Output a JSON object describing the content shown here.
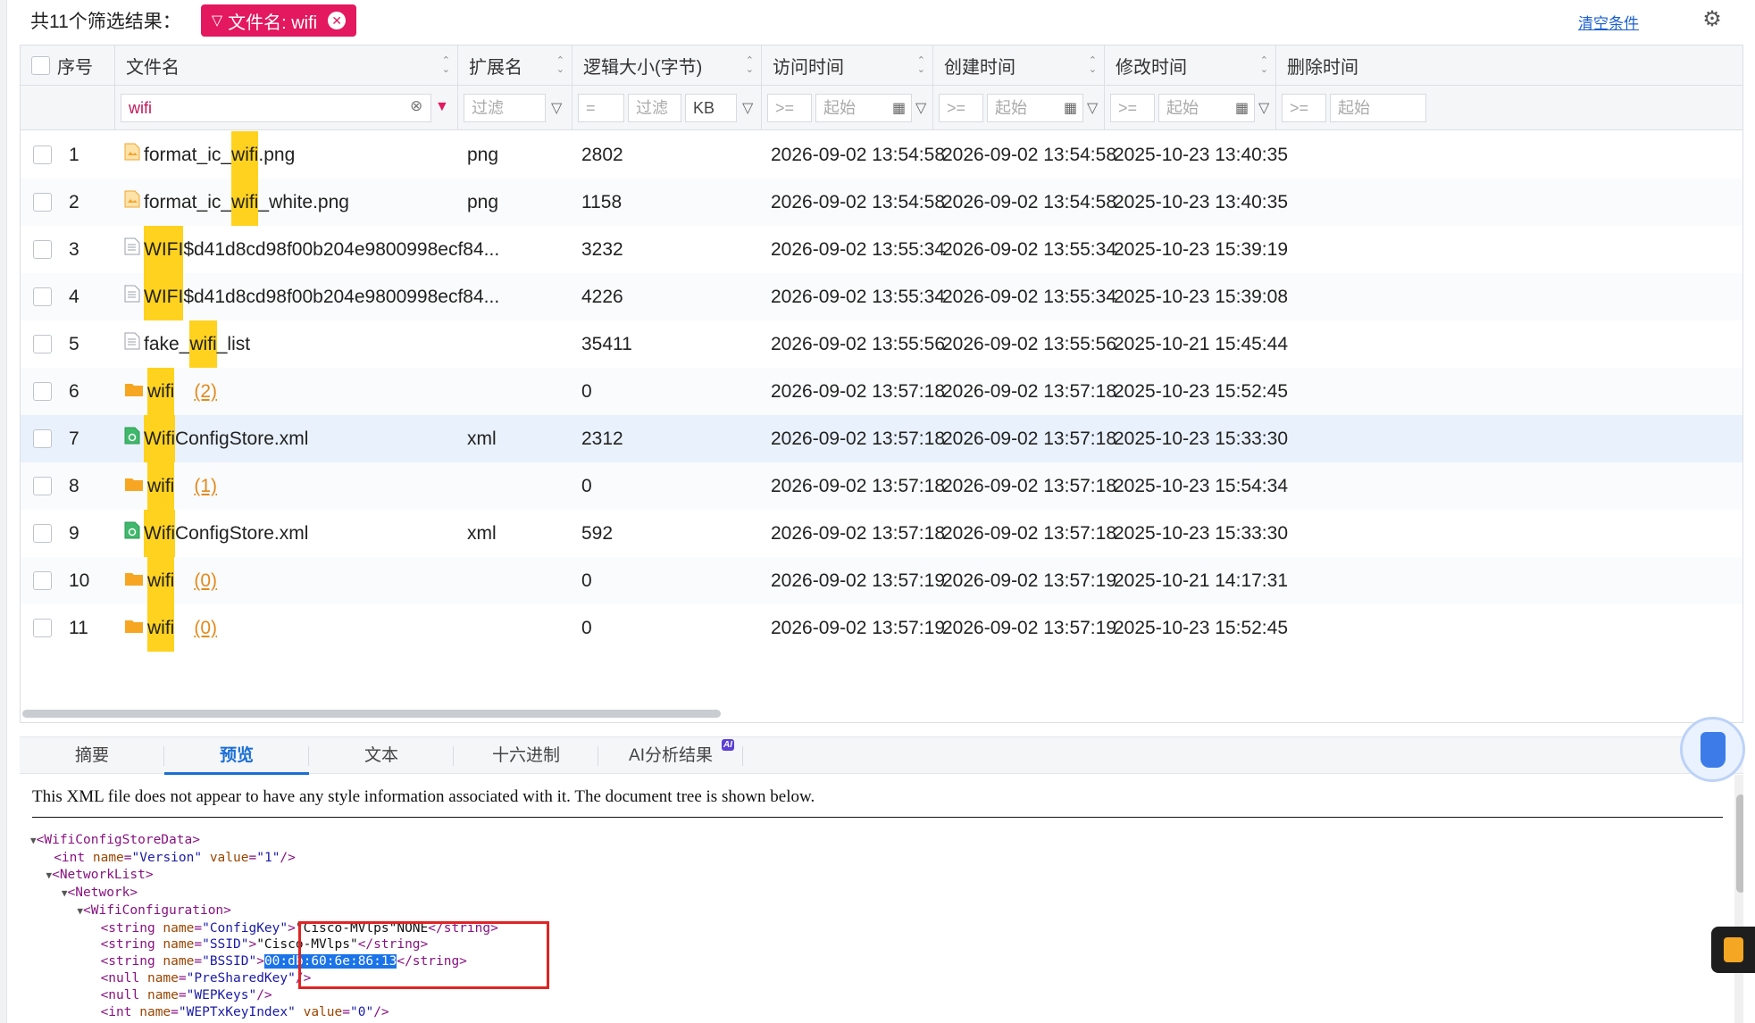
{
  "topbar": {
    "result_count": "共11个筛选结果：",
    "filter_chip": "文件名: wifi",
    "clear_label": "清空条件"
  },
  "columns": {
    "seq": "序号",
    "name": "文件名",
    "ext": "扩展名",
    "size": "逻辑大小(字节)",
    "access": "访问时间",
    "created": "创建时间",
    "modified": "修改时间",
    "deleted": "删除时间"
  },
  "filters": {
    "name_value": "wifi",
    "ext_placeholder": "过滤",
    "size_op": "=",
    "size_placeholder": "过滤",
    "size_unit": "KB",
    "time_op": ">=",
    "time_placeholder": "起始"
  },
  "rows": [
    {
      "seq": "1",
      "icon": "image-file-icon",
      "pre": "format_ic_",
      "hl": "wifi",
      "post": ".png",
      "count": "",
      "ext": "png",
      "size": "2802",
      "access": "2026-09-02 13:54:58",
      "created": "2026-09-02 13:54:58",
      "modified": "2025-10-23 13:40:35"
    },
    {
      "seq": "2",
      "icon": "image-file-icon",
      "pre": "format_ic_",
      "hl": "wifi",
      "post": "_white.png",
      "count": "",
      "ext": "png",
      "size": "1158",
      "access": "2026-09-02 13:54:58",
      "created": "2026-09-02 13:54:58",
      "modified": "2025-10-23 13:40:35"
    },
    {
      "seq": "3",
      "icon": "text-file-icon",
      "pre": "",
      "hl": "WIFI",
      "post": "$d41d8cd98f00b204e9800998ecf84...",
      "count": "",
      "ext": "",
      "size": "3232",
      "access": "2026-09-02 13:55:34",
      "created": "2026-09-02 13:55:34",
      "modified": "2025-10-23 15:39:19"
    },
    {
      "seq": "4",
      "icon": "text-file-icon",
      "pre": "",
      "hl": "WIFI",
      "post": "$d41d8cd98f00b204e9800998ecf84...",
      "count": "",
      "ext": "",
      "size": "4226",
      "access": "2026-09-02 13:55:34",
      "created": "2026-09-02 13:55:34",
      "modified": "2025-10-23 15:39:08"
    },
    {
      "seq": "5",
      "icon": "text-file-icon",
      "pre": "fake_",
      "hl": "wifi",
      "post": "_list",
      "count": "",
      "ext": "",
      "size": "35411",
      "access": "2026-09-02 13:55:56",
      "created": "2026-09-02 13:55:56",
      "modified": "2025-10-21 15:45:44"
    },
    {
      "seq": "6",
      "icon": "folder-icon",
      "pre": "",
      "hl": "wifi",
      "post": "",
      "count": "(2)",
      "ext": "",
      "size": "0",
      "access": "2026-09-02 13:57:18",
      "created": "2026-09-02 13:57:18",
      "modified": "2025-10-23 15:52:45"
    },
    {
      "seq": "7",
      "icon": "xml-file-icon",
      "pre": "",
      "hl": "Wifi",
      "post": "ConfigStore.xml",
      "count": "",
      "ext": "xml",
      "size": "2312",
      "access": "2026-09-02 13:57:18",
      "created": "2026-09-02 13:57:18",
      "modified": "2025-10-23 15:33:30"
    },
    {
      "seq": "8",
      "icon": "folder-icon",
      "pre": "",
      "hl": "wifi",
      "post": "",
      "count": "(1)",
      "ext": "",
      "size": "0",
      "access": "2026-09-02 13:57:18",
      "created": "2026-09-02 13:57:18",
      "modified": "2025-10-23 15:54:34"
    },
    {
      "seq": "9",
      "icon": "xml-file-icon",
      "pre": "",
      "hl": "Wifi",
      "post": "ConfigStore.xml",
      "count": "",
      "ext": "xml",
      "size": "592",
      "access": "2026-09-02 13:57:18",
      "created": "2026-09-02 13:57:18",
      "modified": "2025-10-23 15:33:30"
    },
    {
      "seq": "10",
      "icon": "folder-icon",
      "pre": "",
      "hl": "wifi",
      "post": "",
      "count": "(0)",
      "ext": "",
      "size": "0",
      "access": "2026-09-02 13:57:19",
      "created": "2026-09-02 13:57:19",
      "modified": "2025-10-21 14:17:31"
    },
    {
      "seq": "11",
      "icon": "folder-icon",
      "pre": "",
      "hl": "wifi",
      "post": "",
      "count": "(0)",
      "ext": "",
      "size": "0",
      "access": "2026-09-02 13:57:19",
      "created": "2026-09-02 13:57:19",
      "modified": "2025-10-23 15:52:45"
    }
  ],
  "selected_row": "7",
  "tabs": [
    "摘要",
    "预览",
    "文本",
    "十六进制",
    "AI分析结果"
  ],
  "active_tab": "预览",
  "ai_badge": "AI",
  "preview": {
    "note": "This XML file does not appear to have any style information associated with it. The document tree is shown below.",
    "root_tag": "WifiConfigStoreData",
    "version_name": "Version",
    "version_value": "1",
    "networklist_tag": "NetworkList",
    "network_tag": "Network",
    "wificonfig_tag": "WifiConfiguration",
    "configkey_name": "ConfigKey",
    "configkey_text": "\"Cisco-MVlps\"NONE",
    "ssid_name": "SSID",
    "ssid_text": "\"Cisco-MVlps\"",
    "bssid_name": "BSSID",
    "bssid_text": "00:db:60:6e:86:13",
    "psk_name": "PreSharedKey",
    "wepkeys_name": "WEPKeys",
    "weptx_name": "WEPTxKeyIndex",
    "weptx_value": "0"
  },
  "colors": {
    "accent": "#e3185e",
    "highlight": "#ffd21f",
    "link": "#1a5fd0",
    "selected_row": "#e9f1fc",
    "tab_active": "#1a6fd6",
    "annotation_box": "#e02424"
  }
}
